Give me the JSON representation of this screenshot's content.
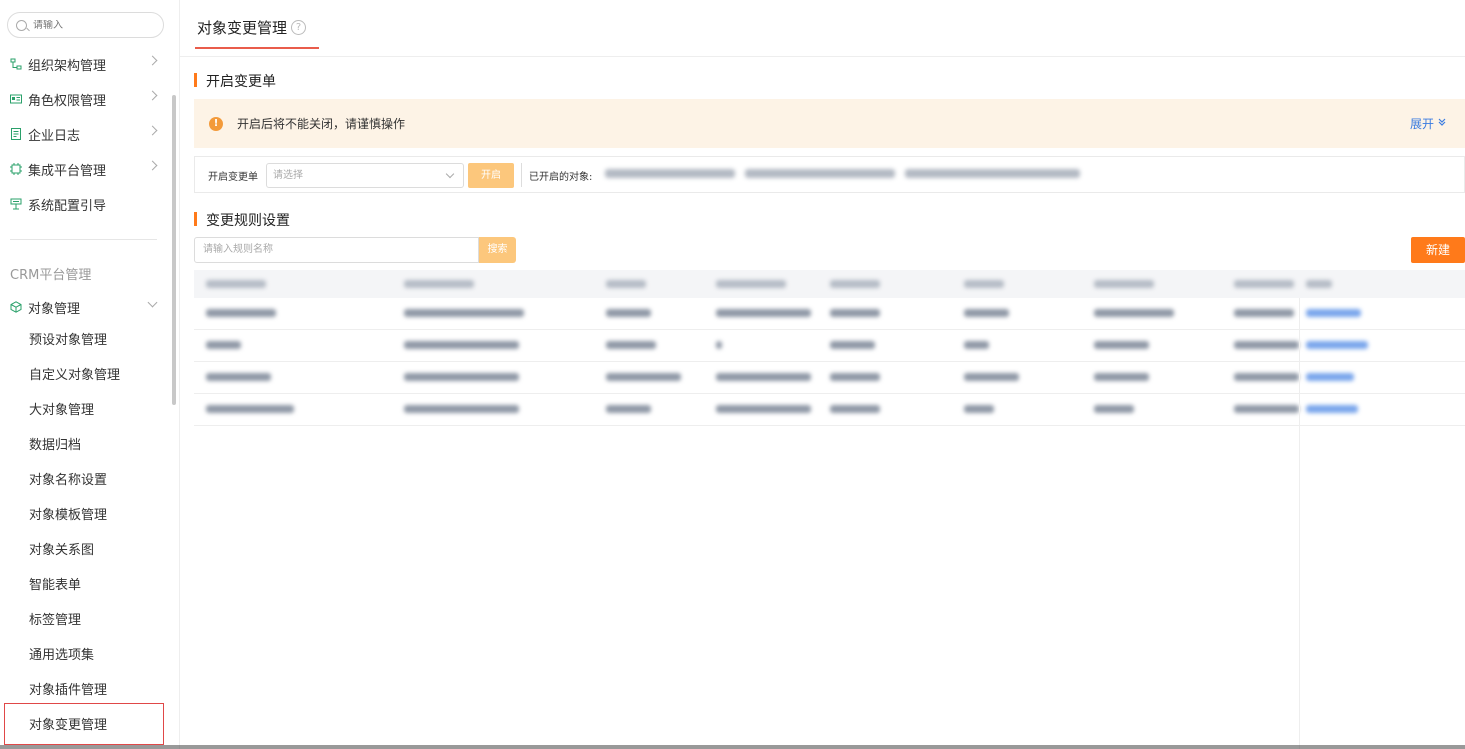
{
  "sidebar": {
    "search_placeholder": "请输入",
    "menu": [
      {
        "label": "组织架构管理",
        "icon": "org-chart-icon"
      },
      {
        "label": "角色权限管理",
        "icon": "id-card-icon"
      },
      {
        "label": "企业日志",
        "icon": "log-document-icon"
      },
      {
        "label": "集成平台管理",
        "icon": "integration-icon"
      },
      {
        "label": "系统配置引导",
        "icon": "config-guide-icon"
      }
    ],
    "section_label": "CRM平台管理",
    "object_mgmt": {
      "label": "对象管理",
      "icon": "object-cube-icon"
    },
    "sub_items": [
      "预设对象管理",
      "自定义对象管理",
      "大对象管理",
      "数据归档",
      "对象名称设置",
      "对象模板管理",
      "对象关系图",
      "智能表单",
      "标签管理",
      "通用选项集",
      "对象插件管理",
      "对象变更管理"
    ],
    "active_item": "对象变更管理"
  },
  "header": {
    "title": "对象变更管理",
    "help_icon": "question-circle-icon"
  },
  "open_section": {
    "title": "开启变更单",
    "alert_text": "开启后将不能关闭，请谨慎操作",
    "expand_label": "展开",
    "field_label": "开启变更单",
    "select_placeholder": "请选择",
    "open_button": "开启",
    "opened_label": "已开启的对象:"
  },
  "rules_section": {
    "title": "变更规则设置",
    "search_placeholder": "请输入规则名称",
    "search_button": "搜索",
    "new_button": "新建"
  },
  "colors": {
    "accent_orange": "#ff7a1a",
    "light_orange": "#fcc77c",
    "link_blue": "#3a7be0",
    "active_border": "#e04848",
    "alert_bg": "#fdf3e6"
  }
}
